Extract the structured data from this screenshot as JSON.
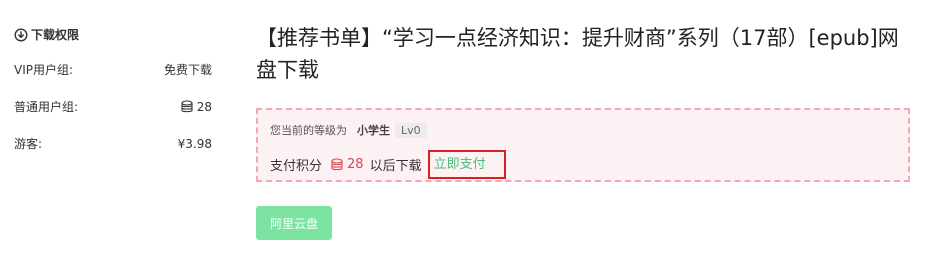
{
  "sidebar": {
    "title": "下载权限",
    "rows": [
      {
        "label": "VIP用户组:",
        "value": "免费下载"
      },
      {
        "label": "普通用户组:",
        "value": "28"
      },
      {
        "label": "游客:",
        "value": "¥3.98"
      }
    ]
  },
  "main": {
    "title": "【推荐书单】“学习一点经济知识：提升财商”系列（17部）[epub]网盘下载",
    "notice": {
      "level_prefix": "您当前的等级为",
      "level_name": "小学生",
      "level_badge": "Lv0",
      "pay_prefix": "支付积分",
      "points": "28",
      "pay_suffix": "以后下载",
      "pay_link": "立即支付"
    },
    "download_button": "阿里云盘"
  },
  "colors": {
    "accent_green": "#4ac07a",
    "points_red": "#e0454f",
    "highlight_border": "#d91f1f",
    "button_green": "#7de3a2",
    "notice_border": "#f3a8b2",
    "notice_bg": "#fdf2f3"
  }
}
